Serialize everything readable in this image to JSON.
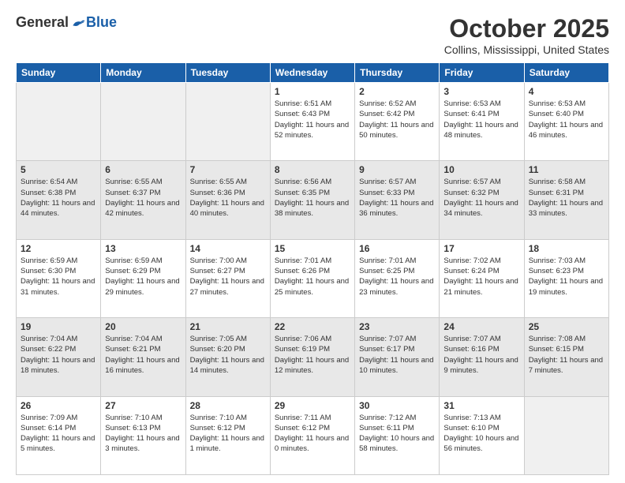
{
  "header": {
    "logo_general": "General",
    "logo_blue": "Blue",
    "month_title": "October 2025",
    "location": "Collins, Mississippi, United States"
  },
  "days_of_week": [
    "Sunday",
    "Monday",
    "Tuesday",
    "Wednesday",
    "Thursday",
    "Friday",
    "Saturday"
  ],
  "weeks": [
    {
      "shaded": false,
      "days": [
        {
          "num": "",
          "empty": true
        },
        {
          "num": "",
          "empty": true
        },
        {
          "num": "",
          "empty": true
        },
        {
          "num": "1",
          "sunrise": "6:51 AM",
          "sunset": "6:43 PM",
          "daylight": "11 hours and 52 minutes."
        },
        {
          "num": "2",
          "sunrise": "6:52 AM",
          "sunset": "6:42 PM",
          "daylight": "11 hours and 50 minutes."
        },
        {
          "num": "3",
          "sunrise": "6:53 AM",
          "sunset": "6:41 PM",
          "daylight": "11 hours and 48 minutes."
        },
        {
          "num": "4",
          "sunrise": "6:53 AM",
          "sunset": "6:40 PM",
          "daylight": "11 hours and 46 minutes."
        }
      ]
    },
    {
      "shaded": true,
      "days": [
        {
          "num": "5",
          "sunrise": "6:54 AM",
          "sunset": "6:38 PM",
          "daylight": "11 hours and 44 minutes."
        },
        {
          "num": "6",
          "sunrise": "6:55 AM",
          "sunset": "6:37 PM",
          "daylight": "11 hours and 42 minutes."
        },
        {
          "num": "7",
          "sunrise": "6:55 AM",
          "sunset": "6:36 PM",
          "daylight": "11 hours and 40 minutes."
        },
        {
          "num": "8",
          "sunrise": "6:56 AM",
          "sunset": "6:35 PM",
          "daylight": "11 hours and 38 minutes."
        },
        {
          "num": "9",
          "sunrise": "6:57 AM",
          "sunset": "6:33 PM",
          "daylight": "11 hours and 36 minutes."
        },
        {
          "num": "10",
          "sunrise": "6:57 AM",
          "sunset": "6:32 PM",
          "daylight": "11 hours and 34 minutes."
        },
        {
          "num": "11",
          "sunrise": "6:58 AM",
          "sunset": "6:31 PM",
          "daylight": "11 hours and 33 minutes."
        }
      ]
    },
    {
      "shaded": false,
      "days": [
        {
          "num": "12",
          "sunrise": "6:59 AM",
          "sunset": "6:30 PM",
          "daylight": "11 hours and 31 minutes."
        },
        {
          "num": "13",
          "sunrise": "6:59 AM",
          "sunset": "6:29 PM",
          "daylight": "11 hours and 29 minutes."
        },
        {
          "num": "14",
          "sunrise": "7:00 AM",
          "sunset": "6:27 PM",
          "daylight": "11 hours and 27 minutes."
        },
        {
          "num": "15",
          "sunrise": "7:01 AM",
          "sunset": "6:26 PM",
          "daylight": "11 hours and 25 minutes."
        },
        {
          "num": "16",
          "sunrise": "7:01 AM",
          "sunset": "6:25 PM",
          "daylight": "11 hours and 23 minutes."
        },
        {
          "num": "17",
          "sunrise": "7:02 AM",
          "sunset": "6:24 PM",
          "daylight": "11 hours and 21 minutes."
        },
        {
          "num": "18",
          "sunrise": "7:03 AM",
          "sunset": "6:23 PM",
          "daylight": "11 hours and 19 minutes."
        }
      ]
    },
    {
      "shaded": true,
      "days": [
        {
          "num": "19",
          "sunrise": "7:04 AM",
          "sunset": "6:22 PM",
          "daylight": "11 hours and 18 minutes."
        },
        {
          "num": "20",
          "sunrise": "7:04 AM",
          "sunset": "6:21 PM",
          "daylight": "11 hours and 16 minutes."
        },
        {
          "num": "21",
          "sunrise": "7:05 AM",
          "sunset": "6:20 PM",
          "daylight": "11 hours and 14 minutes."
        },
        {
          "num": "22",
          "sunrise": "7:06 AM",
          "sunset": "6:19 PM",
          "daylight": "11 hours and 12 minutes."
        },
        {
          "num": "23",
          "sunrise": "7:07 AM",
          "sunset": "6:17 PM",
          "daylight": "11 hours and 10 minutes."
        },
        {
          "num": "24",
          "sunrise": "7:07 AM",
          "sunset": "6:16 PM",
          "daylight": "11 hours and 9 minutes."
        },
        {
          "num": "25",
          "sunrise": "7:08 AM",
          "sunset": "6:15 PM",
          "daylight": "11 hours and 7 minutes."
        }
      ]
    },
    {
      "shaded": false,
      "days": [
        {
          "num": "26",
          "sunrise": "7:09 AM",
          "sunset": "6:14 PM",
          "daylight": "11 hours and 5 minutes."
        },
        {
          "num": "27",
          "sunrise": "7:10 AM",
          "sunset": "6:13 PM",
          "daylight": "11 hours and 3 minutes."
        },
        {
          "num": "28",
          "sunrise": "7:10 AM",
          "sunset": "6:12 PM",
          "daylight": "11 hours and 1 minute."
        },
        {
          "num": "29",
          "sunrise": "7:11 AM",
          "sunset": "6:12 PM",
          "daylight": "11 hours and 0 minutes."
        },
        {
          "num": "30",
          "sunrise": "7:12 AM",
          "sunset": "6:11 PM",
          "daylight": "10 hours and 58 minutes."
        },
        {
          "num": "31",
          "sunrise": "7:13 AM",
          "sunset": "6:10 PM",
          "daylight": "10 hours and 56 minutes."
        },
        {
          "num": "",
          "empty": true
        }
      ]
    }
  ]
}
